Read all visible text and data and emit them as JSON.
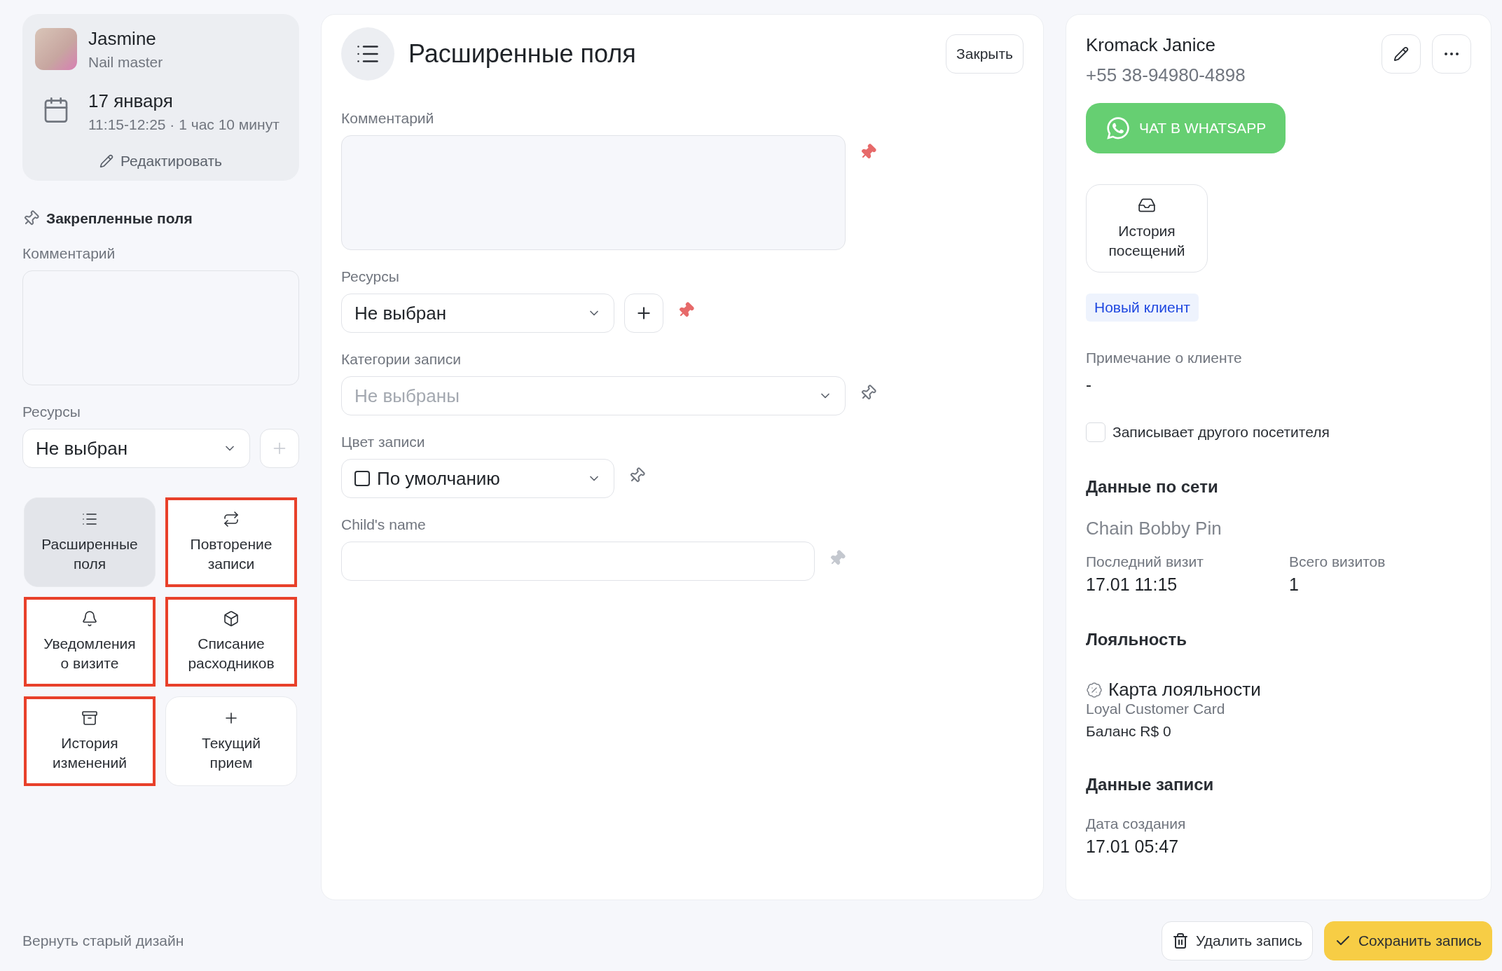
{
  "master": {
    "name": "Jasmine",
    "role": "Nail master"
  },
  "appointment": {
    "date": "17 января",
    "time": "11:15-12:25 · 1 час 10 минут"
  },
  "edit_link": "Редактировать",
  "pinned_fields": {
    "title": "Закрепленные поля",
    "comment_label": "Комментарий",
    "resources_label": "Ресурсы",
    "resources_value": "Не выбран"
  },
  "tiles": [
    {
      "label": "Расширенные поля",
      "selected": true,
      "highlighted": false
    },
    {
      "label": "Повторение записи",
      "selected": false,
      "highlighted": true
    },
    {
      "label": "Уведомления о визите",
      "selected": false,
      "highlighted": true
    },
    {
      "label": "Списание расходников",
      "selected": false,
      "highlighted": true
    },
    {
      "label": "История изменений",
      "selected": false,
      "highlighted": true
    },
    {
      "label": "Текущий прием",
      "selected": false,
      "highlighted": false
    }
  ],
  "old_design_link": "Вернуть старый дизайн",
  "panel": {
    "title": "Расширенные поля",
    "close": "Закрыть",
    "fields": [
      {
        "kind": "textarea",
        "label": "Комментарий",
        "pinned": true,
        "disabled": false
      },
      {
        "kind": "resource",
        "label": "Ресурсы",
        "value": "Не выбран",
        "pinned": true,
        "disabled": false
      },
      {
        "kind": "select",
        "label": "Категории записи",
        "placeholder": "Не выбраны",
        "pinned": false,
        "disabled": false
      },
      {
        "kind": "color",
        "label": "Цвет записи",
        "value": "По умолчанию",
        "checked": false,
        "pinned": false,
        "disabled": false
      },
      {
        "kind": "input",
        "label": "Child's name",
        "pinned": true,
        "disabled": true
      }
    ]
  },
  "client": {
    "name": "Kromack Janice",
    "phone": "+55 38-94980-4898",
    "whatsapp": "ЧАТ В WHATSAPP",
    "history": "История посещений",
    "badge": "Новый клиент",
    "note_label": "Примечание о клиенте",
    "note_value": "-",
    "other_visitor": {
      "label": "Записывает другого посетителя",
      "checked": false
    },
    "network": {
      "title": "Данные по сети",
      "chain": "Chain Bobby Pin",
      "stats": [
        {
          "label": "Последний визит",
          "value": "17.01 11:15"
        },
        {
          "label": "Всего визитов",
          "value": "1"
        }
      ]
    },
    "loyalty": {
      "title": "Лояльность",
      "card": "Карта лояльности",
      "card_name": "Loyal Customer Card",
      "balance": "Баланс R$ 0"
    },
    "record": {
      "title": "Данные записи",
      "created_label": "Дата создания",
      "created_value": "17.01 05:47"
    }
  },
  "actions": {
    "delete": "Удалить запись",
    "save": "Сохранить запись"
  }
}
